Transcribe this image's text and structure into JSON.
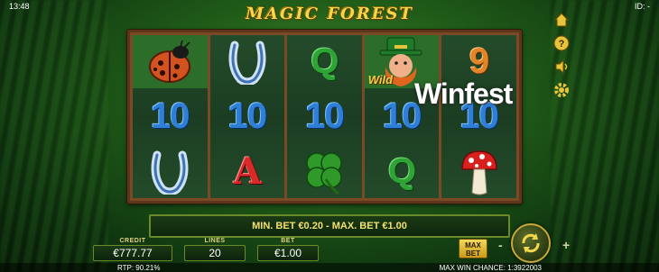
{
  "topbar": {
    "time": "13:48",
    "id_label": "ID: -"
  },
  "game": {
    "title": "MAGIC FOREST"
  },
  "reels": [
    [
      {
        "symbol": "ladybug-icon",
        "text": "",
        "win": true
      },
      {
        "symbol": "10",
        "text": "10"
      },
      {
        "symbol": "horseshoe-icon",
        "text": ""
      }
    ],
    [
      {
        "symbol": "horseshoe-icon",
        "text": ""
      },
      {
        "symbol": "10",
        "text": "10"
      },
      {
        "symbol": "A",
        "text": "A"
      }
    ],
    [
      {
        "symbol": "Q",
        "text": "Q"
      },
      {
        "symbol": "10",
        "text": "10"
      },
      {
        "symbol": "clover-icon",
        "text": ""
      }
    ],
    [
      {
        "symbol": "leprechaun-wild-icon",
        "text": "",
        "wild_label": "Wild"
      },
      {
        "symbol": "10",
        "text": "10"
      },
      {
        "symbol": "Q",
        "text": "Q"
      }
    ],
    [
      {
        "symbol": "9",
        "text": "9"
      },
      {
        "symbol": "10",
        "text": "10"
      },
      {
        "symbol": "mushroom-icon",
        "text": ""
      }
    ]
  ],
  "watermark": "Winfest",
  "side_menu": [
    {
      "name": "home-icon"
    },
    {
      "name": "help-icon"
    },
    {
      "name": "sound-icon"
    },
    {
      "name": "settings-icon"
    }
  ],
  "message": "MIN. BET €0.20 - MAX. BET €1.00",
  "stats": {
    "credit_label": "CREDIT",
    "credit_value": "€777.77",
    "lines_label": "LINES",
    "lines_value": "20",
    "bet_label": "BET",
    "bet_value": "€1.00"
  },
  "controls": {
    "maxbet_line1": "MAX",
    "maxbet_line2": "BET",
    "minus": "-",
    "plus": "+"
  },
  "footer": {
    "rtp": "RTP: 90.21%",
    "max_win": "MAX WIN CHANCE: 1:3922003"
  },
  "colors": {
    "gold": "#f2d74a",
    "felt": "#1c3d22",
    "frame": "#7a4a26"
  }
}
